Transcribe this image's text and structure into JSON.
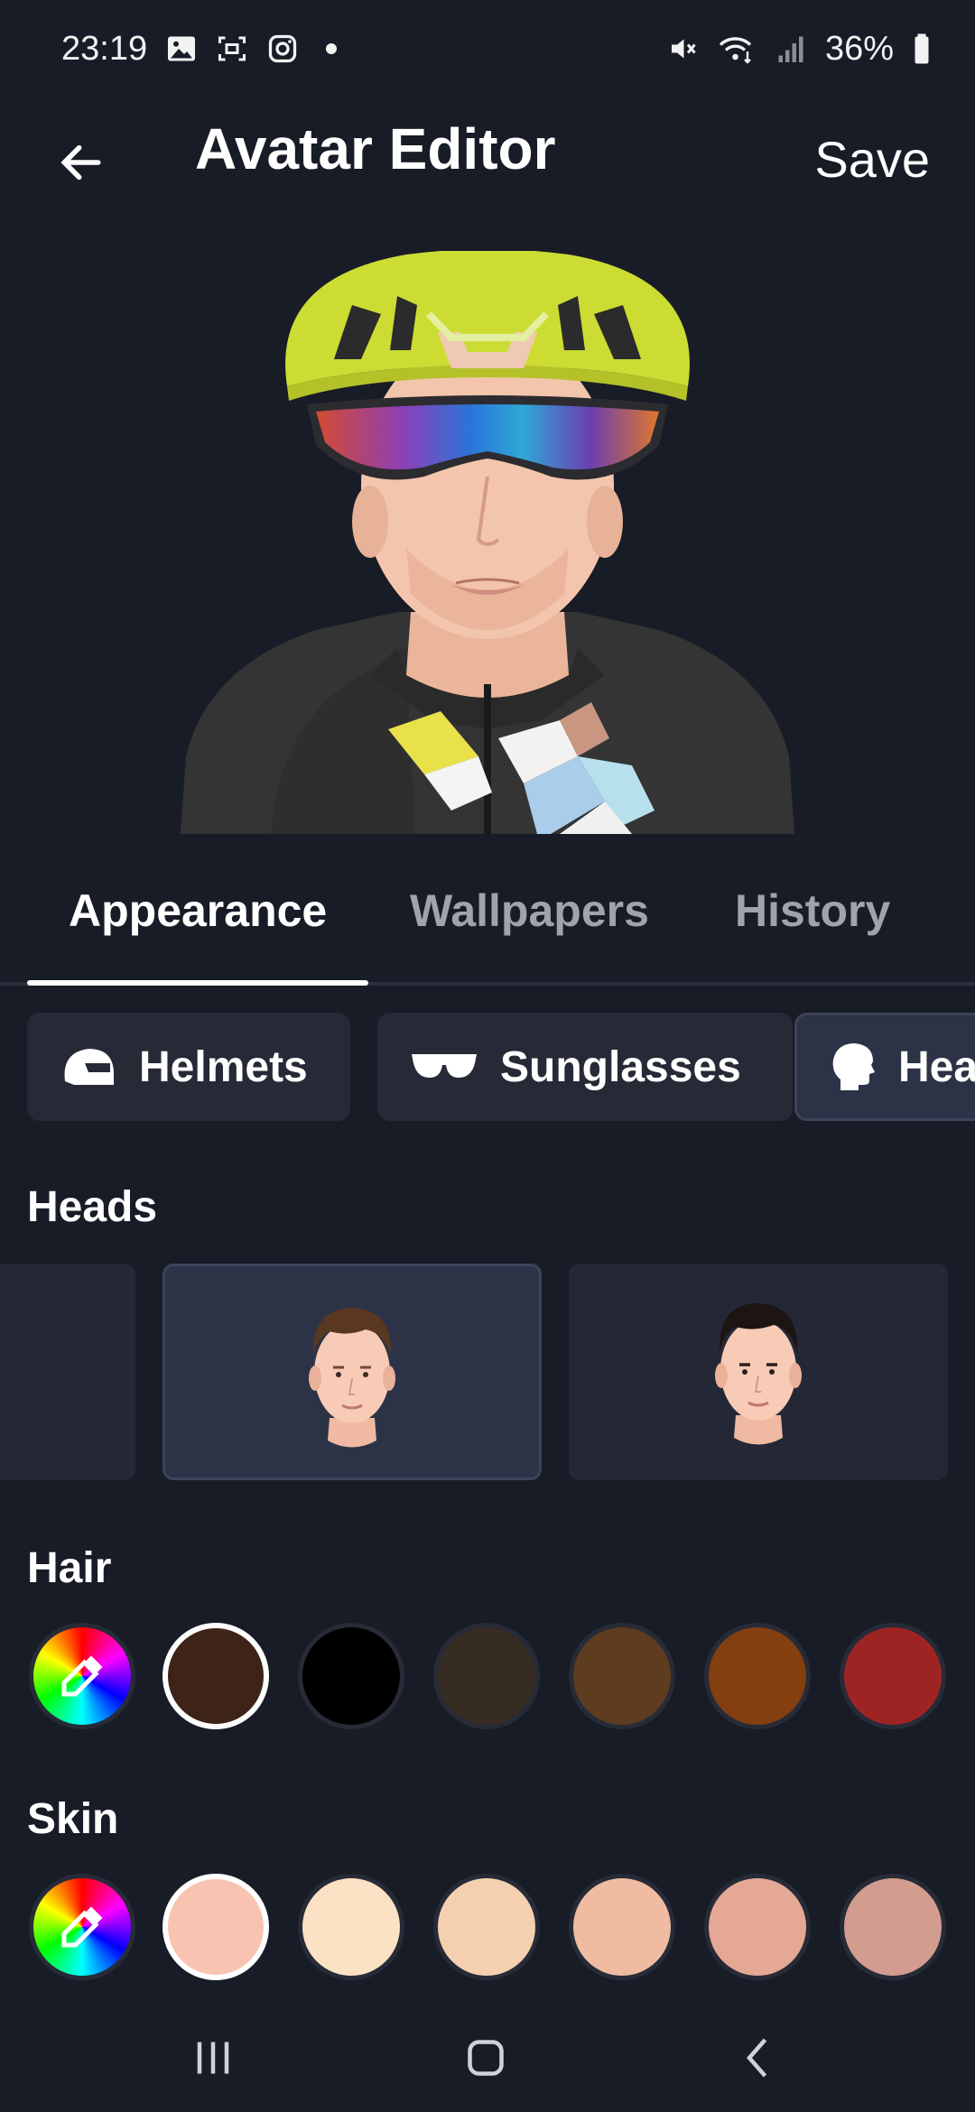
{
  "status_bar": {
    "time": "23:19",
    "battery": "36%",
    "icons_left": [
      "gallery-icon",
      "screenshot-icon",
      "instagram-icon",
      "notification-dot-icon"
    ],
    "icons_right": [
      "mute-icon",
      "wifi-icon",
      "signal-icon",
      "battery-icon"
    ]
  },
  "app_bar": {
    "title": "Avatar Editor",
    "save_label": "Save",
    "back_icon": "arrow-left-icon"
  },
  "tabs": [
    {
      "label": "Appearance",
      "active": true
    },
    {
      "label": "Wallpapers",
      "active": false
    },
    {
      "label": "History",
      "active": false
    }
  ],
  "categories": [
    {
      "label": "Helmets",
      "icon": "helmet-icon"
    },
    {
      "label": "Sunglasses",
      "icon": "sunglasses-icon"
    },
    {
      "label": "Hea",
      "icon": "head-icon",
      "selected": true
    }
  ],
  "heads": {
    "title": "Heads",
    "items": [
      {
        "hair_color": "#5a3720",
        "selected": false
      },
      {
        "hair_color": "#5a3720",
        "selected": true
      },
      {
        "hair_color": "#1c1512",
        "selected": false
      }
    ]
  },
  "hair": {
    "title": "Hair",
    "colors": [
      "#3e2417",
      "#000000",
      "#362c22",
      "#5e3c1f",
      "#833f10",
      "#9e2424"
    ],
    "selected_index": 0
  },
  "skin": {
    "title": "Skin",
    "colors": [
      "#f8c4b1",
      "#fbe2c4",
      "#f5d0b0",
      "#efbba1",
      "#e4a894",
      "#d29c8f"
    ],
    "selected_index": 0
  },
  "colors": {
    "background": "#181c27",
    "card": "#262a37",
    "helmet": "#cddc32",
    "jersey": "#343434"
  },
  "nav_bar": {
    "icons": [
      "recents-icon",
      "home-icon",
      "back-icon"
    ]
  }
}
